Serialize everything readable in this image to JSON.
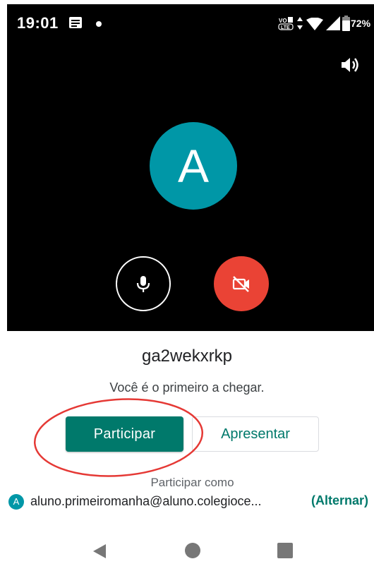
{
  "status_bar": {
    "time": "19:01",
    "battery": "72%",
    "icons": [
      "notification-icon",
      "dot-icon",
      "volte-icon",
      "data-arrows-icon",
      "wifi-icon",
      "signal-icon",
      "battery-icon"
    ]
  },
  "preview": {
    "avatar_letter": "A",
    "speaker_icon": "speaker-icon",
    "mic_icon": "mic-icon",
    "camera_off_icon": "camera-off-icon",
    "avatar_color": "#0097a7",
    "camera_off_color": "#ea4335"
  },
  "meeting": {
    "code": "ga2wekxrkp",
    "status": "Você é o primeiro a chegar."
  },
  "buttons": {
    "join": "Participar",
    "present": "Apresentar",
    "accent": "#00796b"
  },
  "account": {
    "join_as_label": "Participar como",
    "avatar_letter": "A",
    "email": "aluno.primeiromanha@aluno.colegioce...",
    "switch": "(Alternar)"
  },
  "navigation": {
    "icons": [
      "back-icon",
      "home-icon",
      "recents-icon"
    ]
  }
}
